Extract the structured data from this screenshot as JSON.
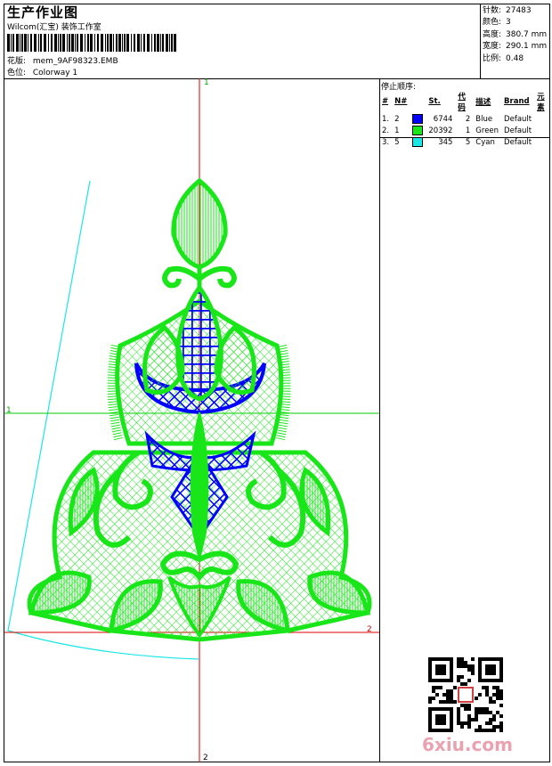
{
  "header": {
    "title": "生产作业图",
    "company": "Wilcom(汇宝) 装饰工作室",
    "design_label": "花版:",
    "design_value": "mem_9AF98323.EMB",
    "colorway_label": "色位:",
    "colorway_value": "Colorway 1"
  },
  "stats": [
    {
      "label": "针数:",
      "value": "27483"
    },
    {
      "label": "颜色:",
      "value": "3"
    },
    {
      "label": "高度:",
      "value": "380.7 mm"
    },
    {
      "label": "宽度:",
      "value": "290.1 mm"
    },
    {
      "label": "比例:",
      "value": "0.48"
    }
  ],
  "sequence": {
    "title": "停止顺序:",
    "headers": [
      "#",
      "N#",
      "St.",
      "代码",
      "描述",
      "Brand",
      "元素"
    ],
    "rows": [
      {
        "idx": "1.",
        "n": "2",
        "color": "#0000ff",
        "st": "6744",
        "code": "2",
        "desc": "Blue",
        "brand": "Default"
      },
      {
        "idx": "2.",
        "n": "1",
        "color": "#19e619",
        "st": "20392",
        "code": "1",
        "desc": "Green",
        "brand": "Default"
      },
      {
        "idx": "3.",
        "n": "5",
        "color": "#1ae6e6",
        "st": "345",
        "code": "5",
        "desc": "Cyan",
        "brand": "Default"
      }
    ]
  },
  "axes": {
    "top": "1",
    "left": "1",
    "right": "2",
    "bottom": "2"
  },
  "colors": {
    "blue": "#0000ff",
    "green": "#19e619",
    "cyan": "#1ae6e6",
    "axis_red": "#dd0000",
    "axis_green": "#00cc00"
  },
  "watermark": "6xiu.com",
  "icons": {
    "qr": "qr-code-icon",
    "seal": "red-seal-icon"
  }
}
